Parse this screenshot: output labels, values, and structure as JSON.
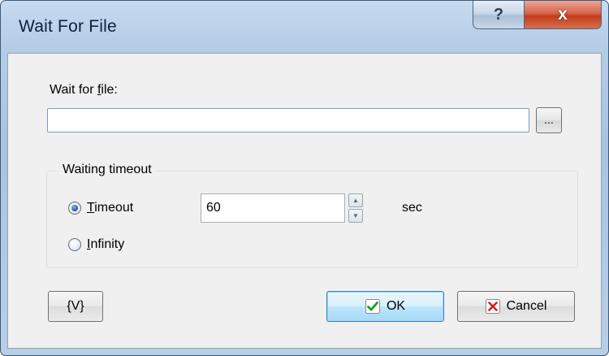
{
  "window": {
    "title": "Wait For File",
    "help_label": "?",
    "close_label": "x"
  },
  "file": {
    "label_before": "Wait for ",
    "label_accel": "f",
    "label_after": "ile:",
    "value": "",
    "browse_label": "..."
  },
  "timeout_group": {
    "title": "Waiting timeout",
    "options": [
      {
        "accel": "T",
        "rest": "imeout",
        "checked": true
      },
      {
        "accel": "I",
        "rest": "nfinity",
        "checked": false
      }
    ],
    "timeout_value": "60",
    "unit": "sec"
  },
  "buttons": {
    "variables_label": "{V}",
    "ok_label": "OK",
    "cancel_label": "Cancel"
  },
  "colors": {
    "ok_check": "#1a9e1a",
    "cancel_x": "#d12020",
    "radio_dot": "#2b5fa8"
  }
}
